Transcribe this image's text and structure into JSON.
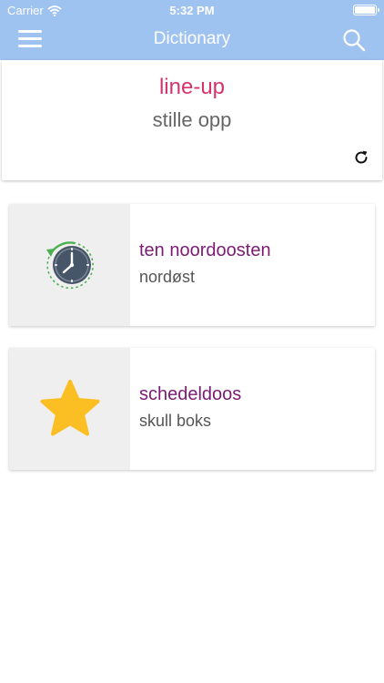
{
  "status_bar": {
    "carrier": "Carrier",
    "time": "5:32 PM"
  },
  "navbar": {
    "title": "Dictionary",
    "menu_icon": "hamburger-menu-icon",
    "search_icon": "search-icon"
  },
  "featured": {
    "word": "line-up",
    "translation": "stille opp",
    "refresh_icon": "refresh-icon"
  },
  "cards": [
    {
      "term": "ten noordoosten",
      "meaning": "nordøst",
      "icon": "history-clock-icon"
    },
    {
      "term": "schedeldoos",
      "meaning": "skull boks",
      "icon": "star-icon"
    }
  ],
  "colors": {
    "header": "#9fc3f0",
    "featured_word": "#d6336c",
    "term": "#7b1b73",
    "star": "#fbbf24",
    "clock": "#475569",
    "clock_arrow": "#4caf50"
  }
}
